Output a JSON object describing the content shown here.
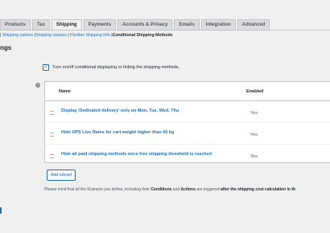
{
  "tabs": [
    {
      "label": "Products",
      "active": false
    },
    {
      "label": "Tax",
      "active": false
    },
    {
      "label": "Shipping",
      "active": true
    },
    {
      "label": "Payments",
      "active": false
    },
    {
      "label": "Accounts & Privacy",
      "active": false
    },
    {
      "label": "Emails",
      "active": false
    },
    {
      "label": "Integration",
      "active": false
    },
    {
      "label": "Advanced",
      "active": false
    }
  ],
  "subnav": {
    "items": [
      "Shipping options",
      "Shipping classes",
      "Flexible Shipping Info"
    ],
    "current": "Conditional Shipping Methods"
  },
  "page_heading": "ngs",
  "toggle": {
    "checked": true,
    "label": "Turn on/off conditional displaying or hiding the shipping methods."
  },
  "table": {
    "headers": {
      "name": "Name",
      "enabled": "Enabled"
    },
    "rows": [
      {
        "name": "Display 'Dedicated delivery' only on Mon, Tue, Wed, Thu",
        "enabled": "Yes"
      },
      {
        "name": "Hide UPS Live Rates for cart weight higher than 50 kg",
        "enabled": "Yes"
      },
      {
        "name": "Hide all paid shipping methods once free shipping threshold is reached",
        "enabled": "Yes"
      }
    ]
  },
  "add_ruleset_label": "Add ruleset",
  "note": {
    "part1": "Please mind that all the Rulesets you define, including their ",
    "conditions": "Conditions",
    "part2": " and ",
    "actions": "Actions",
    "part3": " are triggered ",
    "emphasis": "after the shipping cost calculation in th"
  },
  "colors": {
    "accent": "#2271b1",
    "background": "#f0f0f1"
  }
}
